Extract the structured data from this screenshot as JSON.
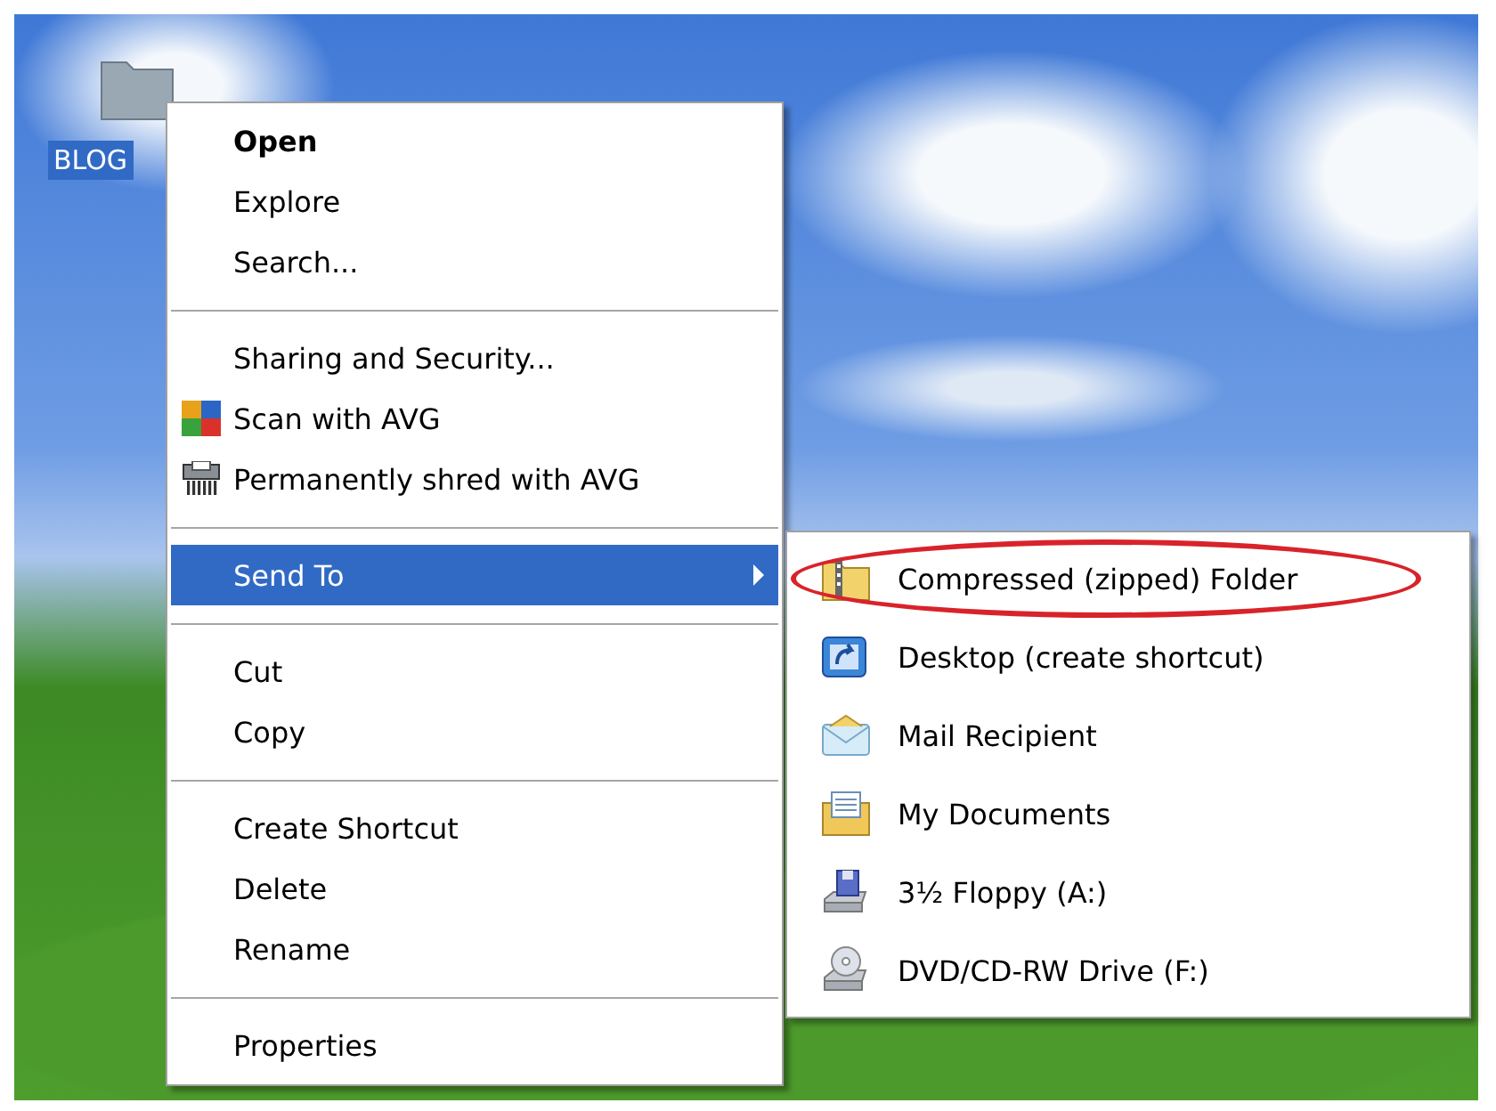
{
  "desktop_icon": {
    "label": "BLOG",
    "selected": true
  },
  "context_menu": {
    "items": [
      {
        "kind": "default",
        "label": "Open"
      },
      {
        "kind": "plain",
        "label": "Explore"
      },
      {
        "kind": "plain",
        "label": "Search..."
      },
      {
        "kind": "separator"
      },
      {
        "kind": "plain",
        "label": "Sharing and Security..."
      },
      {
        "kind": "avg-scan",
        "label": "Scan with AVG"
      },
      {
        "kind": "avg-shred",
        "label": "Permanently shred with AVG"
      },
      {
        "kind": "separator"
      },
      {
        "kind": "submenu",
        "label": "Send To",
        "selected": true
      },
      {
        "kind": "separator"
      },
      {
        "kind": "plain",
        "label": "Cut"
      },
      {
        "kind": "plain",
        "label": "Copy"
      },
      {
        "kind": "separator"
      },
      {
        "kind": "plain",
        "label": "Create Shortcut"
      },
      {
        "kind": "plain",
        "label": "Delete"
      },
      {
        "kind": "plain",
        "label": "Rename"
      },
      {
        "kind": "separator"
      },
      {
        "kind": "plain",
        "label": "Properties"
      }
    ]
  },
  "send_to_menu": {
    "items": [
      {
        "kind": "zip",
        "label": "Compressed (zipped) Folder",
        "circled": true
      },
      {
        "kind": "desktop",
        "label": "Desktop (create shortcut)",
        "circled": false
      },
      {
        "kind": "mail",
        "label": "Mail Recipient",
        "circled": false
      },
      {
        "kind": "documents",
        "label": "My Documents",
        "circled": false
      },
      {
        "kind": "floppy",
        "label": "3½ Floppy (A:)",
        "circled": false
      },
      {
        "kind": "dvd",
        "label": "DVD/CD-RW Drive (F:)",
        "circled": false
      }
    ]
  }
}
